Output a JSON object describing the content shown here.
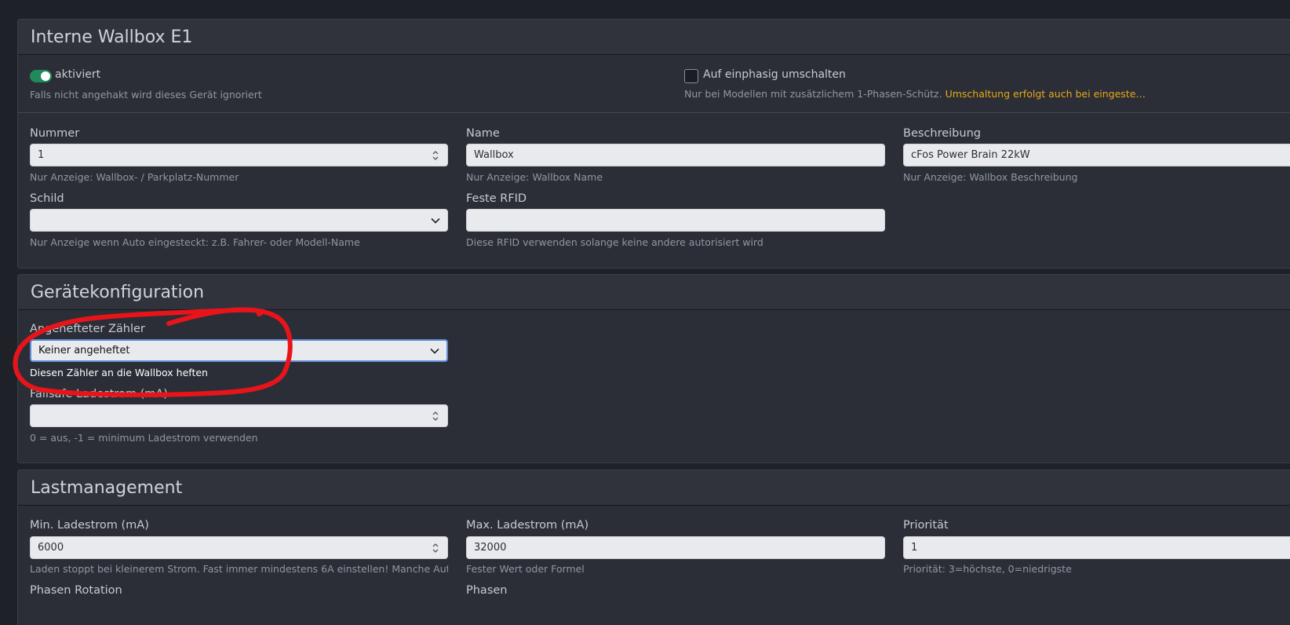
{
  "wallbox": {
    "title": "Interne Wallbox E1",
    "enabled_label": "aktiviert",
    "enabled_help": "Falls nicht angehakt wird dieses Gerät ignoriert",
    "single_phase_label": "Auf einphasig umschalten",
    "single_phase_help": "Nur bei Modellen mit zusätzlichem 1-Phasen-Schütz.",
    "single_phase_warning": "Umschaltung erfolgt auch bei eingeste…",
    "number": {
      "label": "Nummer",
      "value": "1",
      "help": "Nur Anzeige: Wallbox- / Parkplatz-Nummer"
    },
    "name": {
      "label": "Name",
      "value": "Wallbox",
      "help": "Nur Anzeige: Wallbox Name"
    },
    "description": {
      "label": "Beschreibung",
      "value": "cFos Power Brain 22kW",
      "help": "Nur Anzeige: Wallbox Beschreibung"
    },
    "sign": {
      "label": "Schild",
      "value": "",
      "help": "Nur Anzeige wenn Auto eingesteckt: z.B. Fahrer- oder Modell-Name"
    },
    "rfid": {
      "label": "Feste RFID",
      "value": "",
      "help": "Diese RFID verwenden solange keine andere autorisiert wird"
    }
  },
  "device_config": {
    "title": "Gerätekonfiguration",
    "meter": {
      "label": "Angehefteter Zähler",
      "value": "Keiner angeheftet",
      "help": "Diesen Zähler an die Wallbox heften"
    },
    "failsafe": {
      "label": "Failsafe Ladestrom (mA)",
      "value": "",
      "help": "0 = aus, -1 = minimum Ladestrom verwenden"
    }
  },
  "load_management": {
    "title": "Lastmanagement",
    "min_current": {
      "label": "Min. Ladestrom (mA)",
      "value": "6000",
      "help": "Laden stoppt bei kleinerem Strom. Fast immer mindestens 6A einstellen! Manche Autos ben…"
    },
    "max_current": {
      "label": "Max. Ladestrom (mA)",
      "value": "32000",
      "help": "Fester Wert oder Formel"
    },
    "priority": {
      "label": "Priorität",
      "value": "1",
      "help": "Priorität: 3=höchste, 0=niedrigste"
    },
    "phase_rotation": {
      "label": "Phasen Rotation"
    },
    "phases": {
      "label": "Phasen"
    }
  },
  "colors": {
    "background": "#1e2127",
    "card": "#2b2e36",
    "toggle_on": "#1f8a5b",
    "warning": "#e6a817",
    "annotation": "#e8141a"
  },
  "icons": {
    "spinner": "updown-spinner-icon",
    "dropdown": "chevron-down-icon"
  }
}
